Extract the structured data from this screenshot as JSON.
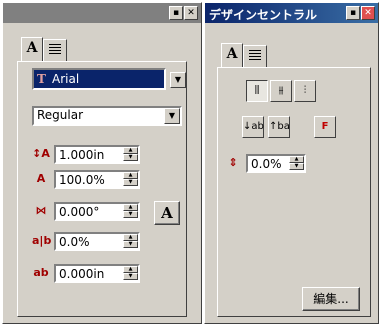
{
  "left": {
    "title_buttons": [
      "▪",
      "✕"
    ],
    "tabs": [
      {
        "label": "A"
      },
      {
        "label": ""
      }
    ],
    "font": {
      "name": "Arial",
      "icon_glyph": "T"
    },
    "style": {
      "value": "Regular"
    },
    "fields": [
      {
        "icon": "font-size-icon",
        "glyph": "↕A",
        "value": "1.000in"
      },
      {
        "icon": "scale-icon",
        "glyph": "A",
        "value": "100.0%"
      },
      {
        "icon": "rotation-icon",
        "glyph": "⋈",
        "value": "0.000°"
      },
      {
        "icon": "spacing-icon",
        "glyph": "a|b",
        "value": "0.0%"
      },
      {
        "icon": "baseline-icon",
        "glyph": "ab",
        "value": "0.000in"
      }
    ],
    "a_button": "A"
  },
  "right": {
    "title": "デザインセントラル",
    "tabs": [
      {
        "label": "A"
      },
      {
        "label": ""
      }
    ],
    "spin_value": "0.0%",
    "edit_button": "編集..."
  }
}
